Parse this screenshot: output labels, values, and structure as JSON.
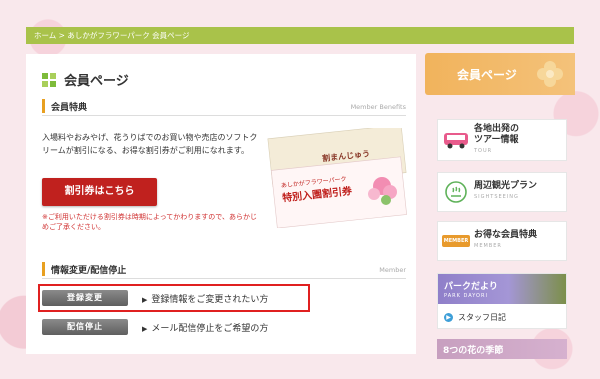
{
  "breadcrumb": "ホーム > あしかがフラワーパーク 会員ページ",
  "page_title": "会員ページ",
  "benefits": {
    "heading": "会員特典",
    "heading_en": "Member Benefits",
    "text": "入場料やおみやげ、花うりばでのお買い物や売店のソフトクリームが割引になる、お得な割引券がご利用になれます。",
    "button_label": "割引券はこちら",
    "note": "※ご利用いただける割引券は時期によってかわりますので、あらかじめご了承ください。",
    "coupon": {
      "park_name": "あしかがフラワーパーク",
      "ticket_title": "特別入園割引券",
      "back_text": "割まんじゅう"
    }
  },
  "info": {
    "heading": "情報変更/配信停止",
    "heading_en": "Member",
    "register_button": "登録変更",
    "register_text": "登録情報をご変更されたい方",
    "unsubscribe_button": "配信停止",
    "unsubscribe_text": "メール配信停止をご希望の方"
  },
  "sidebar": {
    "header": "会員ページ",
    "tour": {
      "label_line1": "各地出発の",
      "label_line2": "ツアー情報",
      "sub": "TOUR"
    },
    "sightseeing": {
      "label": "周辺観光プラン",
      "sub": "SIGHTSEEING"
    },
    "member": {
      "label": "お得な会員特典",
      "sub": "MEMBER",
      "badge": "MEMBER"
    },
    "park": {
      "title": "パークだより",
      "sub": "PARK DAYORI",
      "link": "スタッフ日記"
    },
    "bottom_banner": "8つの花の季節"
  },
  "colors": {
    "breadcrumb_bg": "#a9c24a",
    "accent_orange": "#e8a020",
    "coupon_red": "#c0211e",
    "highlight_red": "#e02020",
    "sidebar_header": "#f1b35c"
  }
}
